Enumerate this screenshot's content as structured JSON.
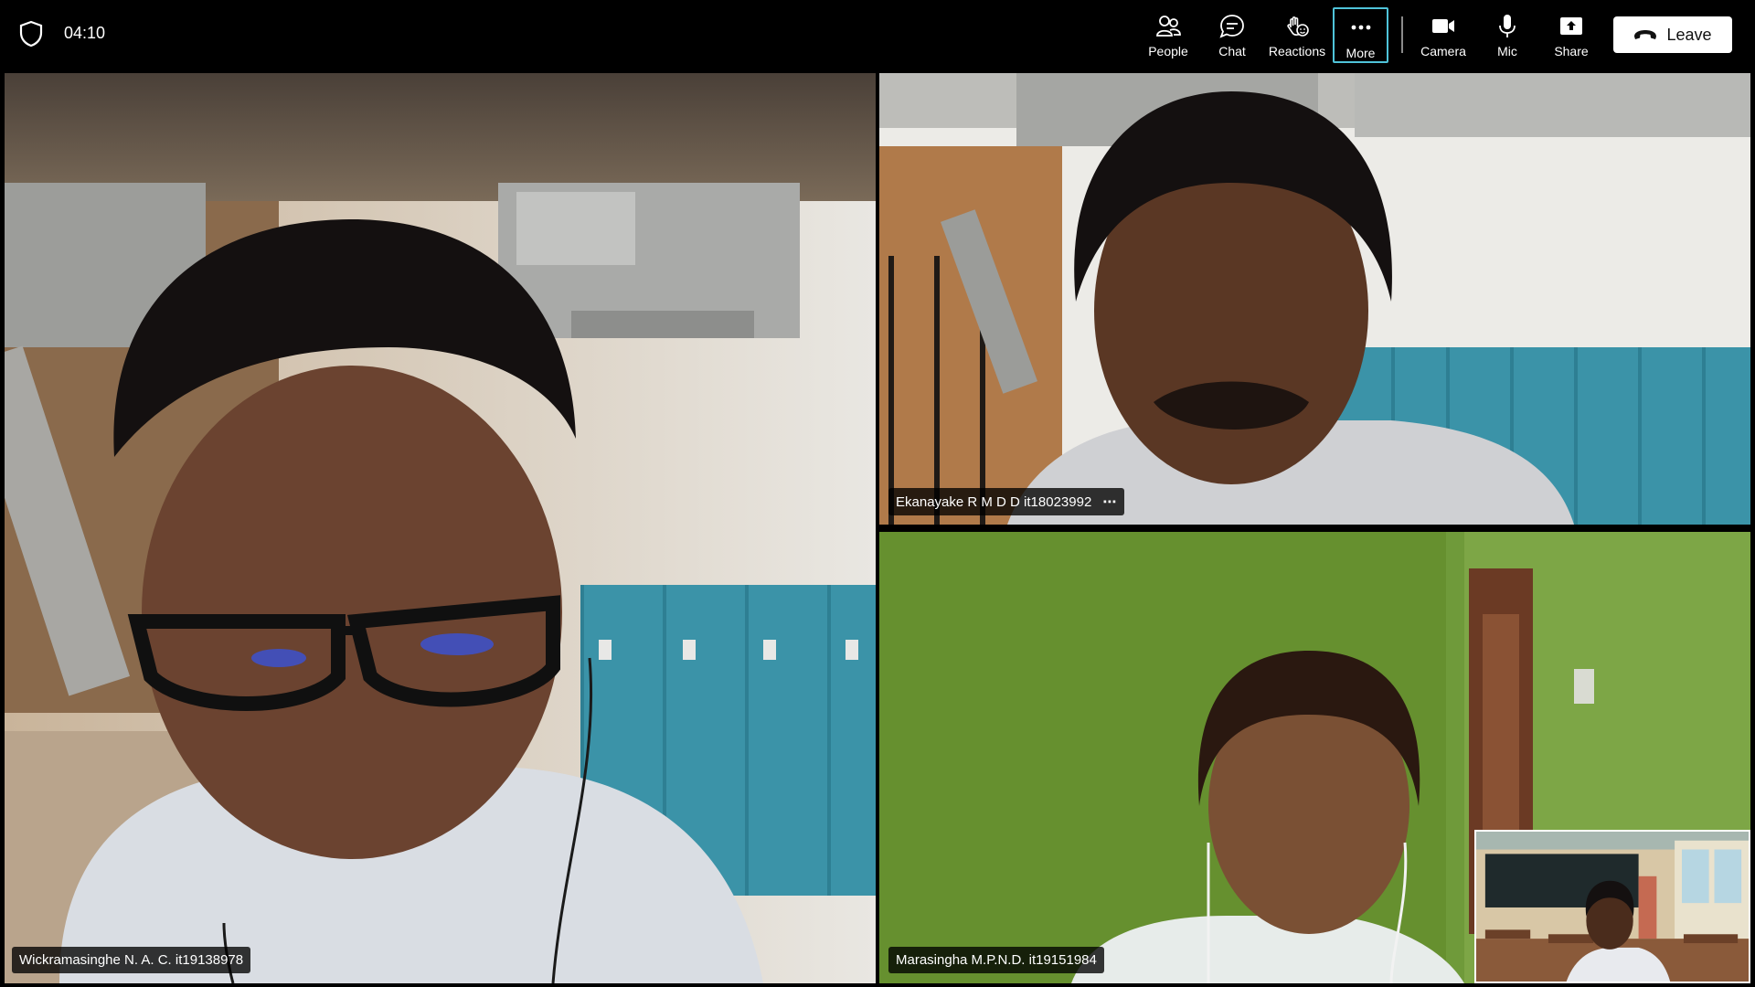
{
  "call": {
    "timer": "04:10"
  },
  "controls": [
    {
      "label": "People",
      "icon": "people-icon"
    },
    {
      "label": "Chat",
      "icon": "chat-icon"
    },
    {
      "label": "Reactions",
      "icon": "reactions-icon"
    },
    {
      "label": "More",
      "icon": "more-icon",
      "active": true
    },
    {
      "label": "Camera",
      "icon": "camera-icon"
    },
    {
      "label": "Mic",
      "icon": "mic-icon"
    },
    {
      "label": "Share",
      "icon": "share-icon"
    }
  ],
  "leave": {
    "label": "Leave",
    "icon": "hangup-icon"
  },
  "participants": [
    {
      "name": "Wickramasinghe N. A. C. it19138978"
    },
    {
      "name": "Ekanayake R M D D it18023992",
      "more": "⋯"
    },
    {
      "name": "Marasingha M.P.N.D. it19151984"
    }
  ],
  "colors": {
    "active_border": "#4fc3d9",
    "leave_bg": "#ffffff",
    "locker_blue": "#3b93a8",
    "wall_green": "#6f9a3a"
  }
}
